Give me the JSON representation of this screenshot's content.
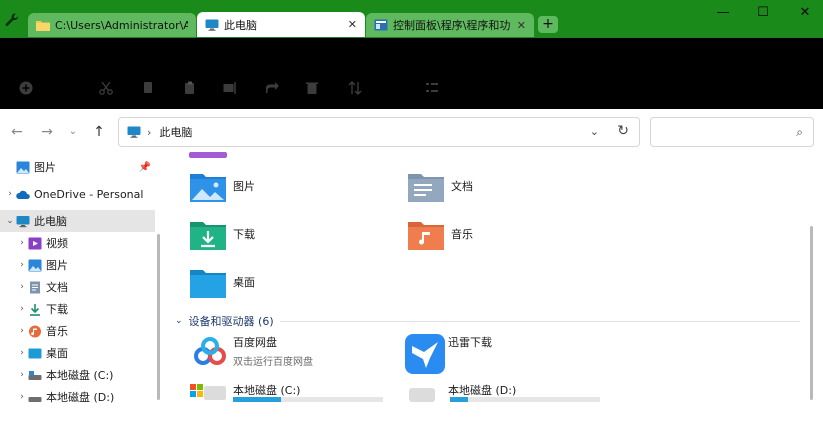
{
  "tabs": [
    {
      "label": "C:\\Users\\Administrator\\A",
      "active": false
    },
    {
      "label": "此电脑",
      "active": true
    },
    {
      "label": "控制面板\\程序\\程序和功能",
      "active": false
    }
  ],
  "newtab_label": "+",
  "window_controls": {
    "minimize": "—",
    "maximize": "☐",
    "close": "✕"
  },
  "address": {
    "crumb": "此电脑",
    "search_placeholder": ""
  },
  "sidebar": {
    "items": [
      {
        "label": "图片",
        "icon": "pictures-icon",
        "pinned": true
      },
      {
        "label": "OneDrive - Personal",
        "icon": "onedrive-icon"
      },
      {
        "label": "此电脑",
        "icon": "pc-icon",
        "selected": true
      },
      {
        "label": "视频",
        "icon": "videos-icon"
      },
      {
        "label": "图片",
        "icon": "pictures-icon"
      },
      {
        "label": "文档",
        "icon": "documents-icon"
      },
      {
        "label": "下载",
        "icon": "downloads-icon"
      },
      {
        "label": "音乐",
        "icon": "music-icon"
      },
      {
        "label": "桌面",
        "icon": "desktop-icon"
      },
      {
        "label": "本地磁盘 (C:)",
        "icon": "drive-icon"
      },
      {
        "label": "本地磁盘 (D:)",
        "icon": "drive-icon"
      }
    ]
  },
  "folders": [
    {
      "label": "图片",
      "icon": "pictures-folder-icon"
    },
    {
      "label": "文档",
      "icon": "documents-folder-icon"
    },
    {
      "label": "下载",
      "icon": "downloads-folder-icon"
    },
    {
      "label": "音乐",
      "icon": "music-folder-icon"
    },
    {
      "label": "桌面",
      "icon": "desktop-folder-icon"
    }
  ],
  "devices_group": {
    "label": "设备和驱动器 (6)"
  },
  "devices": [
    {
      "name": "百度网盘",
      "subtitle": "双击运行百度网盘",
      "icon": "baidu-netdisk-icon"
    },
    {
      "name": "迅雷下载",
      "subtitle": "",
      "icon": "xunlei-icon"
    },
    {
      "name": "本地磁盘 (C:)",
      "icon": "drive-icon",
      "usage": 0.32
    },
    {
      "name": "本地磁盘 (D:)",
      "icon": "drive-icon",
      "usage": 0.12
    }
  ],
  "colors": {
    "titlebar": "#1a8a1a",
    "tab_inactive": "#5fb95f",
    "cmdbar": "#000000",
    "accent": "#0078d4",
    "drive_fill": "#26a0da"
  }
}
